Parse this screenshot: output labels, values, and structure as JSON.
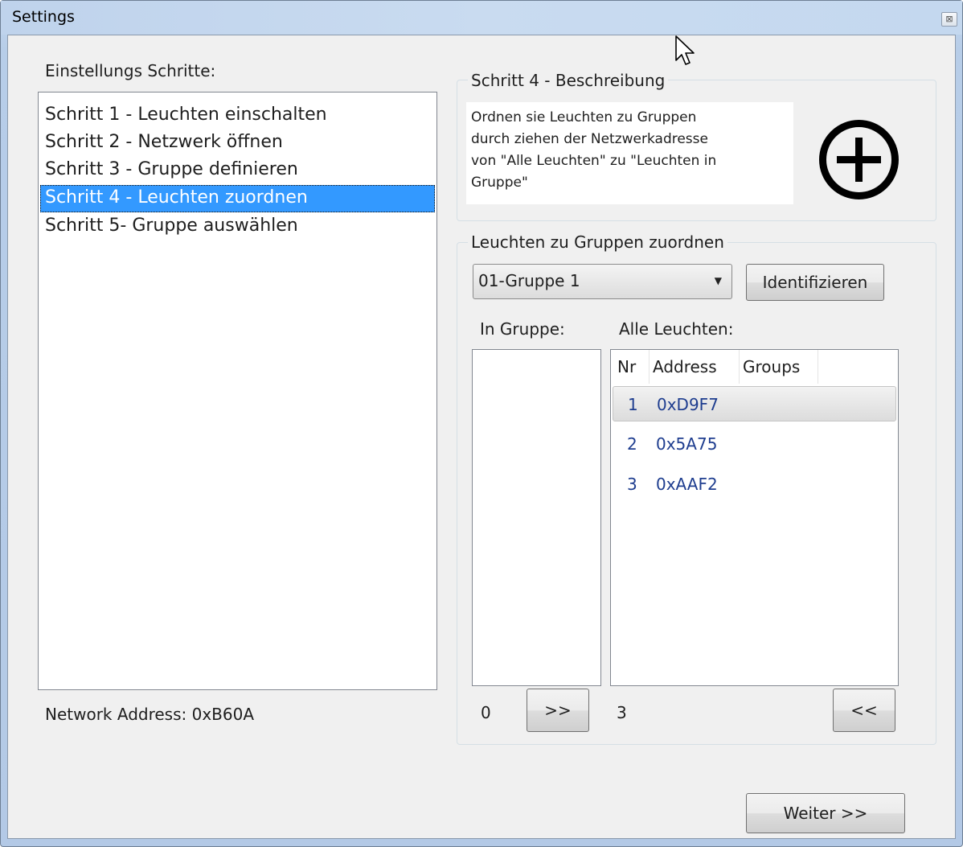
{
  "window": {
    "title": "Settings",
    "close_glyph": "⊠"
  },
  "steps": {
    "label": "Einstellungs Schritte:",
    "items": [
      {
        "label": "Schritt 1 - Leuchten einschalten",
        "selected": false
      },
      {
        "label": "Schritt 2 - Netzwerk öffnen",
        "selected": false
      },
      {
        "label": "Schritt 3 - Gruppe definieren",
        "selected": false
      },
      {
        "label": "Schritt 4 - Leuchten zuordnen",
        "selected": true
      },
      {
        "label": "Schritt 5- Gruppe auswählen",
        "selected": false
      }
    ]
  },
  "network": {
    "label": "Network Address: 0xB60A"
  },
  "description": {
    "title": "Schritt 4 - Beschreibung",
    "text_lines": [
      "Ordnen sie Leuchten zu Gruppen",
      "durch ziehen der Netzwerkadresse",
      "von \"Alle Leuchten\" zu \"Leuchten in",
      "Gruppe\""
    ],
    "icon": "plus-circle-icon"
  },
  "assign": {
    "title": "Leuchten zu Gruppen zuordnen",
    "group_select_value": "01-Gruppe 1",
    "identify_label": "Identifizieren",
    "in_group_label": "In Gruppe:",
    "all_lights_label": "Alle Leuchten:",
    "in_group_count": "0",
    "all_count": "3",
    "add_button": ">>",
    "remove_button": "<<",
    "columns": [
      "Nr",
      "Address",
      "Groups"
    ],
    "rows": [
      {
        "nr": "1",
        "address": "0xD9F7",
        "groups": ""
      },
      {
        "nr": "2",
        "address": "0x5A75",
        "groups": ""
      },
      {
        "nr": "3",
        "address": "0xAAF2",
        "groups": ""
      }
    ]
  },
  "footer": {
    "next_button": "Weiter >>"
  },
  "colors": {
    "selection": "#3399ff",
    "row_text": "#1e3d8f",
    "client_bg": "#f0f0f0"
  }
}
